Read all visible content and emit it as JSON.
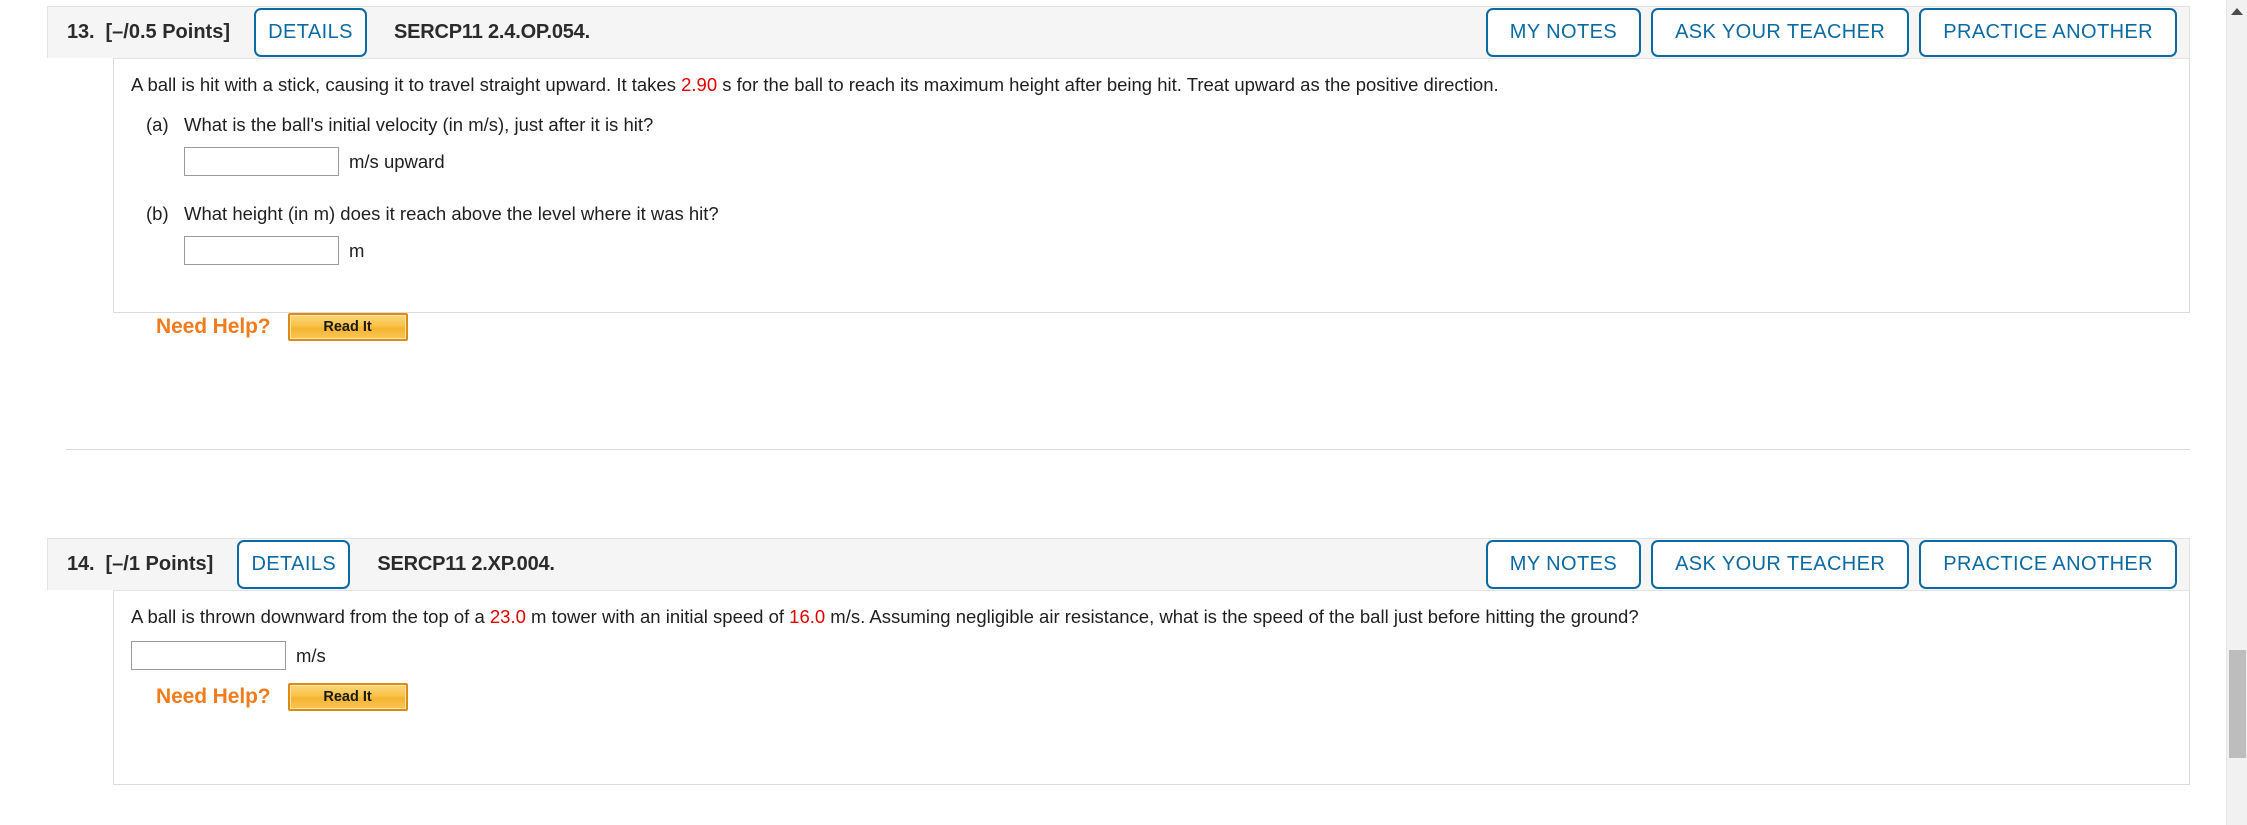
{
  "scrollbar": {
    "up_arrow": "scroll-up-arrow"
  },
  "problems": [
    {
      "number": "13.",
      "points": "[–/0.5 Points]",
      "details_label": "DETAILS",
      "code": "SERCP11 2.4.OP.054.",
      "actions": [
        "MY NOTES",
        "ASK YOUR TEACHER",
        "PRACTICE ANOTHER"
      ],
      "stem": {
        "part1": "A ball is hit with a stick, causing it to travel straight upward. It takes ",
        "value": "2.90",
        "part2": " s for the ball to reach its maximum height after being hit. Treat upward as the positive direction."
      },
      "subparts": [
        {
          "label": "(a)",
          "text": "What is the ball's initial velocity (in m/s), just after it is hit?",
          "input_value": "",
          "input_placeholder": "",
          "unit": "m/s upward"
        },
        {
          "label": "(b)",
          "text": "What height (in m) does it reach above the level where it was hit?",
          "input_value": "",
          "input_placeholder": "",
          "unit": "m"
        }
      ],
      "need_help_label": "Need Help?",
      "read_it_label": "Read It"
    },
    {
      "number": "14.",
      "points": "[–/1 Points]",
      "details_label": "DETAILS",
      "code": "SERCP11 2.XP.004.",
      "actions": [
        "MY NOTES",
        "ASK YOUR TEACHER",
        "PRACTICE ANOTHER"
      ],
      "stem": {
        "part1": "A ball is thrown downward from the top of a ",
        "value1": "23.0",
        "part2": " m tower with an initial speed of ",
        "value2": "16.0",
        "part3": " m/s. Assuming negligible air resistance, what is the speed of the ball just before hitting the ground?"
      },
      "input_value": "",
      "input_placeholder": "",
      "unit": "m/s",
      "need_help_label": "Need Help?",
      "read_it_label": "Read It"
    }
  ],
  "colors": {
    "accent_blue": "#0a6aa1",
    "value_red": "#e00000",
    "need_help_orange": "#f07c1e",
    "header_bg": "#f5f5f5"
  }
}
